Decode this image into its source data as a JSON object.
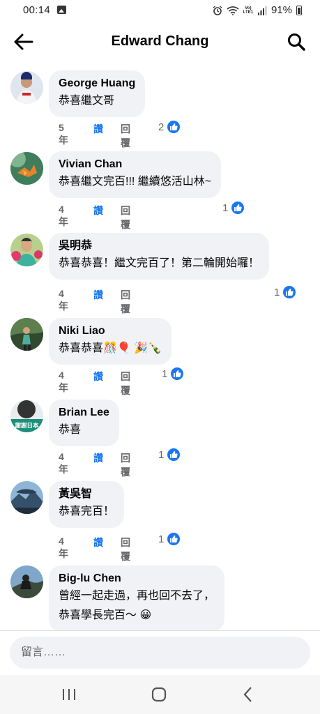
{
  "status_bar": {
    "time": "00:14",
    "battery_pct": "91%",
    "volte_top": "Vo)",
    "volte_bottom": "LTE1"
  },
  "header": {
    "title": "Edward Chang",
    "back_icon": "arrow-left-icon",
    "search_icon": "search-icon"
  },
  "actions": {
    "like_label": "讚",
    "reply_label": "回覆"
  },
  "comments": [
    {
      "name": "George Huang",
      "lines": [
        "恭喜繼文哥"
      ],
      "age": "5年",
      "likes": "2"
    },
    {
      "name": "Vivian Chan",
      "lines": [
        "恭喜繼文完百!!! 繼續悠活山林~"
      ],
      "age": "4年",
      "likes": "1"
    },
    {
      "name": "吳明恭",
      "lines": [
        "恭喜恭喜！繼文完百了！第二輪開始囉！"
      ],
      "age": "4年",
      "likes": "1"
    },
    {
      "name": "Niki Liao",
      "lines": [
        "恭喜恭喜🎊🎈 🎉🍾"
      ],
      "age": "4年",
      "likes": "1"
    },
    {
      "name": "Brian Lee",
      "lines": [
        "恭喜"
      ],
      "age": "4年",
      "likes": "1",
      "avatar_text": "謝謝日本"
    },
    {
      "name": "黃吳智",
      "lines": [
        "恭喜完百！"
      ],
      "age": "4年",
      "likes": "1"
    },
    {
      "name": "Big-lu Chen",
      "lines": [
        "曾經一起走過，再也回不去了，",
        "恭喜學長完百～ 😀"
      ]
    }
  ],
  "input": {
    "placeholder": "留言……"
  },
  "colors": {
    "accent": "#1877f2",
    "bubble": "#f0f2f5",
    "secondary_text": "#65676b"
  }
}
